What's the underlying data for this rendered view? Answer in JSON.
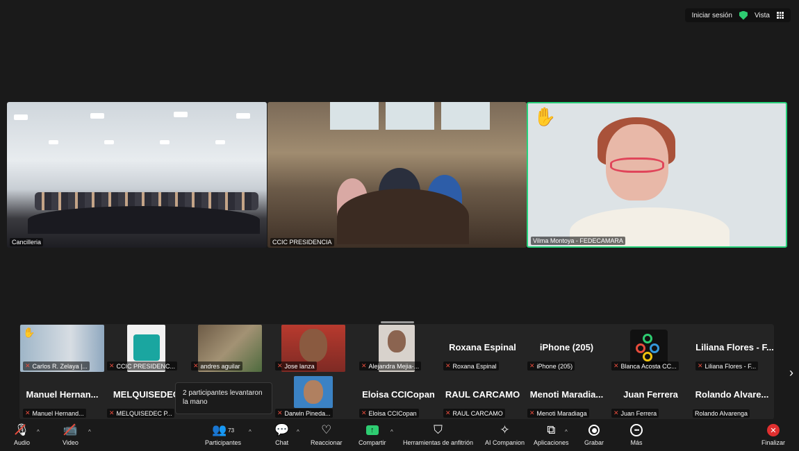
{
  "topbar": {
    "signin": "Iniciar sesión",
    "view": "Vista"
  },
  "main_tiles": [
    {
      "name": "Cancilleria"
    },
    {
      "name": "CCIC PRESIDENCIA"
    },
    {
      "name": "Vilma Montoya - FEDECAMARA"
    }
  ],
  "participants_row1": [
    {
      "big": "",
      "label": "Carlos R. Zelaya |..."
    },
    {
      "big": "",
      "label": "CCIC PRESIDENC..."
    },
    {
      "big": "",
      "label": "andres aguilar"
    },
    {
      "big": "",
      "label": "Jose lanza"
    },
    {
      "big": "",
      "label": "Alejandra Mejia-..."
    },
    {
      "big": "Roxana Espinal",
      "label": "Roxana Espinal"
    },
    {
      "big": "iPhone (205)",
      "label": "iPhone (205)"
    },
    {
      "big": "",
      "label": "Blanca Acosta CC..."
    },
    {
      "big": "Liliana Flores - F...",
      "label": "Liliana Flores - F..."
    }
  ],
  "participants_row2": [
    {
      "big": "Manuel Hernan...",
      "label": "Manuel Hernand..."
    },
    {
      "big": "MELQUISEDEC",
      "label": "MELQUISEDEC P..."
    },
    {
      "big": "",
      "label": ""
    },
    {
      "big": "",
      "label": "Darwin Pineda..."
    },
    {
      "big": "Eloisa CCICopan",
      "label": "Eloisa CCICopan"
    },
    {
      "big": "RAUL CARCAMO",
      "label": "RAUL CARCAMO"
    },
    {
      "big": "Menoti Maradia...",
      "label": "Menoti Maradiaga"
    },
    {
      "big": "Juan Ferrera",
      "label": "Juan Ferrera"
    },
    {
      "big": "Rolando Alvare...",
      "label": "Rolando Alvarenga"
    }
  ],
  "tooltip": "2 participantes levantaron la mano",
  "toolbar": {
    "audio": "Audio",
    "video": "Video",
    "participants": "Participantes",
    "participants_count": "73",
    "chat": "Chat",
    "react": "Reaccionar",
    "share": "Compartir",
    "host_tools": "Herramientas de anfitrión",
    "ai": "AI Companion",
    "apps": "Aplicaciones",
    "record": "Grabar",
    "more": "Más",
    "end": "Finalizar"
  },
  "colors": {
    "active_speaker": "#27d17a",
    "share": "#2ecc71",
    "end": "#e02f2f",
    "hand": "#f5c518"
  },
  "icons": {
    "mic": "mic-off-icon",
    "video": "video-off-icon",
    "participants": "people-icon",
    "chat": "chat-icon",
    "react": "heart-icon",
    "share": "share-screen-icon",
    "host": "shield-icon",
    "ai": "sparkle-icon",
    "apps": "apps-icon",
    "record": "record-icon",
    "more": "more-icon",
    "end": "close-icon"
  }
}
